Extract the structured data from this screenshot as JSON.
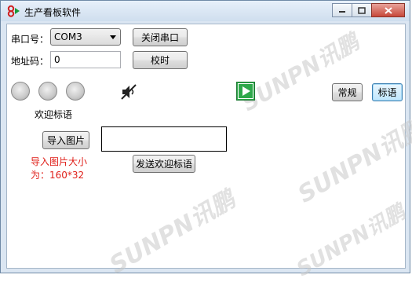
{
  "window": {
    "title": "生产看板软件",
    "controls": [
      "minimize-icon",
      "maximize-icon",
      "close-icon"
    ]
  },
  "form": {
    "port_label": "串口号：",
    "port_value": "COM3",
    "close_port_button": "关闭串口",
    "address_label": "地址码：",
    "address_value": "0",
    "time_sync_button": "校时",
    "welcome_label": "欢迎标语",
    "import_image_button": "导入图片",
    "import_hint_line1": "导入图片大小",
    "import_hint_line2": "为：160*32",
    "send_welcome_button": "发送欢迎标语",
    "mode_normal_button": "常规",
    "mode_slogan_button": "标语"
  },
  "icons": {
    "mute": "speaker-muted-icon",
    "play": "play-icon"
  },
  "colors": {
    "hint_red": "#e0201a",
    "play_green": "#2ea84a"
  }
}
